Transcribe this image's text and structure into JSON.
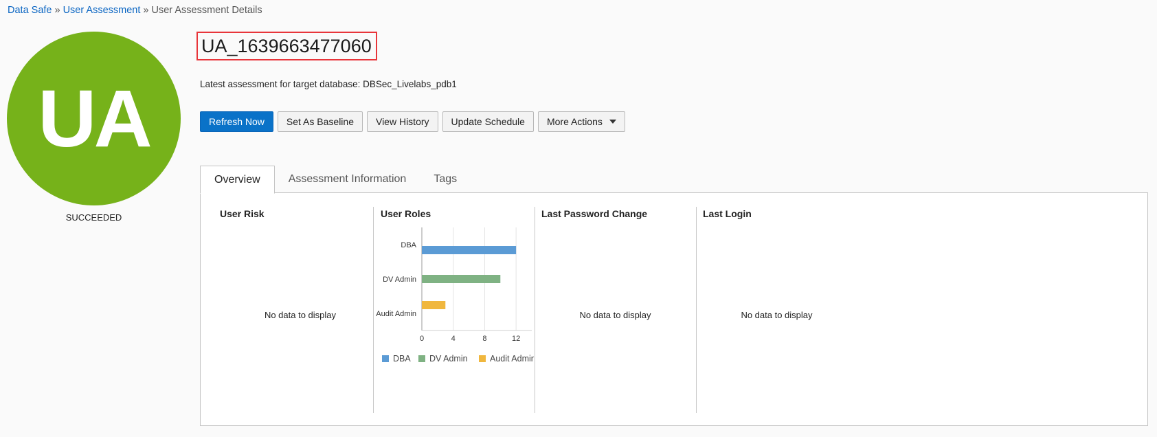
{
  "breadcrumb": {
    "items": [
      "Data Safe",
      "User Assessment",
      "User Assessment Details"
    ],
    "separator": "»"
  },
  "avatar": {
    "initials": "UA",
    "status": "SUCCEEDED",
    "color": "#76b21a"
  },
  "header": {
    "title": "UA_1639663477060",
    "subtitle": "Latest assessment for target database: DBSec_Livelabs_pdb1"
  },
  "actions": {
    "refresh": "Refresh Now",
    "baseline": "Set As Baseline",
    "history": "View History",
    "schedule": "Update Schedule",
    "more": "More Actions"
  },
  "tabs": [
    {
      "label": "Overview",
      "active": true
    },
    {
      "label": "Assessment Information",
      "active": false
    },
    {
      "label": "Tags",
      "active": false
    }
  ],
  "panels": {
    "user_risk": {
      "title": "User Risk",
      "empty": "No data to display"
    },
    "user_roles": {
      "title": "User Roles"
    },
    "last_password_change": {
      "title": "Last Password Change",
      "empty": "No data to display"
    },
    "last_login": {
      "title": "Last Login",
      "empty": "No data to display"
    }
  },
  "chart_data": {
    "type": "bar",
    "orientation": "horizontal",
    "categories": [
      "DBA",
      "DV Admin",
      "Audit Admin"
    ],
    "series": [
      {
        "name": "DBA",
        "values": [
          12,
          null,
          null
        ],
        "color": "#5b9bd5"
      },
      {
        "name": "DV Admin",
        "values": [
          null,
          10,
          null
        ],
        "color": "#7fb283"
      },
      {
        "name": "Audit Admin",
        "values": [
          null,
          null,
          3
        ],
        "color": "#f0b73e"
      }
    ],
    "x_ticks": [
      0,
      4,
      8,
      12
    ],
    "xlim": [
      0,
      14
    ],
    "grid": true,
    "legend_position": "bottom"
  }
}
